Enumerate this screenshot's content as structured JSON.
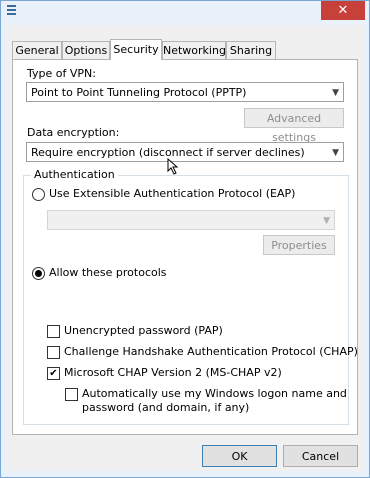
{
  "window": {
    "close_glyph": "✕"
  },
  "tabs": [
    {
      "label": "General"
    },
    {
      "label": "Options"
    },
    {
      "label": "Security"
    },
    {
      "label": "Networking"
    },
    {
      "label": "Sharing"
    }
  ],
  "vpn": {
    "type_label": "Type of VPN:",
    "type_value": "Point to Point Tunneling Protocol (PPTP)",
    "advanced_label": "Advanced settings",
    "encryption_label": "Data encryption:",
    "encryption_value": "Require encryption (disconnect if server declines)"
  },
  "auth": {
    "group_title": "Authentication",
    "eap_label": "Use Extensible Authentication Protocol (EAP)",
    "eap_value": "",
    "properties_label": "Properties",
    "allow_label": "Allow these protocols",
    "protocols": [
      {
        "label": "Unencrypted password (PAP)",
        "checked": false
      },
      {
        "label": "Challenge Handshake Authentication Protocol (CHAP)",
        "checked": false
      },
      {
        "label": "Microsoft CHAP Version 2 (MS-CHAP v2)",
        "checked": true
      }
    ],
    "auto_logon_line1": "Automatically use my Windows logon name and",
    "auto_logon_line2": "password (and domain, if any)",
    "auto_logon_checked": false
  },
  "footer": {
    "ok_label": "OK",
    "cancel_label": "Cancel"
  },
  "icons": {
    "dropdown": "▼",
    "check": "✔"
  }
}
